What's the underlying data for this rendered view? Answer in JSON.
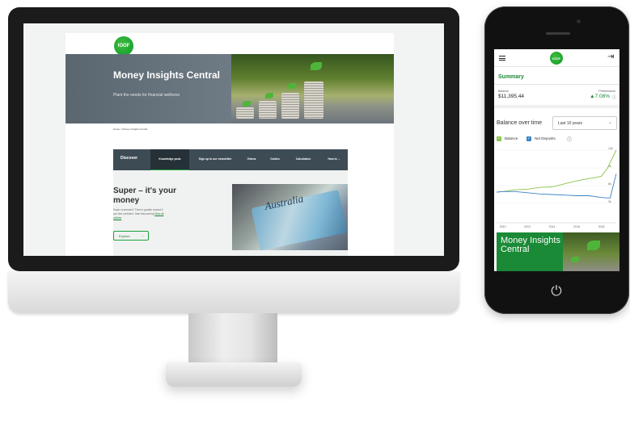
{
  "website": {
    "logo": "IOOF",
    "hero_title": "Money Insights Central",
    "hero_subtitle": "Plant the seeds for financial wellness",
    "breadcrumb": "Home > Money Insights Central",
    "nav": {
      "discover": "Discover",
      "tabs": [
        "Knowledge pods",
        "Sign up to our newsletter",
        "Videos",
        "Guides",
        "Calculators",
        "How to ..."
      ]
    },
    "feature": {
      "title": "Super – it's your money",
      "text": "Super connected? There's greater reward if you feel confident. Start discovering",
      "link": "View all articles",
      "button": "Explore",
      "image_caption": "Australia"
    }
  },
  "phone_app": {
    "logo": "IOOF",
    "summary_title": "Summary",
    "balance_label": "Balance",
    "balance_value": "$11,395.44",
    "performance_label": "Performance",
    "performance_value": "▲7.08%",
    "chart_title": "Balance over time",
    "period_select": "Last 10 years",
    "legend": {
      "balance": "Balance",
      "net_deposits": "Net Deposits"
    },
    "card_title": "Money Insights Central",
    "colors": {
      "balance": "#8bc34a",
      "net_deposits": "#3b82c4",
      "brand": "#1a8a36"
    }
  },
  "chart_data": {
    "type": "line",
    "title": "Balance over time",
    "x": [
      2010,
      2012,
      2014,
      2016,
      2018
    ],
    "ytick_labels": [
      "12k",
      "9k",
      "6k",
      "3k"
    ],
    "ylim": [
      0,
      12000
    ],
    "series": [
      {
        "name": "Balance",
        "x": [
          2009.5,
          2010,
          2011,
          2012,
          2013,
          2014,
          2015,
          2016,
          2017,
          2017.6,
          2018,
          2018.5,
          2019.2
        ],
        "values": [
          4900,
          5000,
          5300,
          5400,
          5700,
          5800,
          6300,
          6800,
          7200,
          7400,
          7600,
          9000,
          12000
        ]
      },
      {
        "name": "Net Deposits",
        "x": [
          2009.5,
          2010,
          2011,
          2012,
          2013,
          2014,
          2015,
          2016,
          2017,
          2018,
          2018.7,
          2019.2
        ],
        "values": [
          4900,
          5000,
          5000,
          4800,
          4600,
          4500,
          4400,
          4300,
          4300,
          4000,
          3900,
          8000
        ]
      }
    ]
  }
}
